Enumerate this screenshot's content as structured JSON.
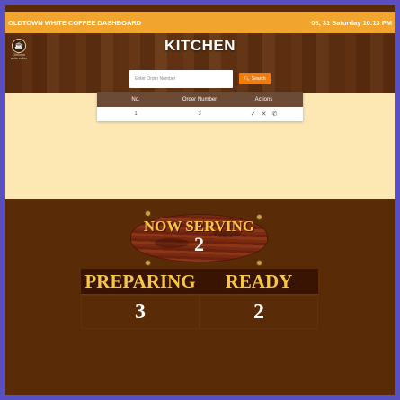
{
  "header": {
    "title": "OLDTOWN WHITE COFFEE DASHBOARD",
    "datetime": "08, 31 Saturday 10:13 PM"
  },
  "logo": {
    "line1": "OldTown",
    "line2": "white coffee"
  },
  "hero": {
    "title": "KITCHEN",
    "search_placeholder": "Enter Order Number",
    "search_button": "Search",
    "search_icon": "search-icon"
  },
  "orders_table": {
    "columns": [
      "No.",
      "Order Number",
      "Actions"
    ],
    "rows": [
      {
        "no": "1",
        "order_number": "3",
        "actions": [
          "check-icon",
          "close-icon",
          "phone-icon"
        ]
      }
    ]
  },
  "now_serving": {
    "label": "NOW SERVING",
    "value": "2"
  },
  "preparing": {
    "label": "PREPARING",
    "value": "3"
  },
  "ready": {
    "label": "READY",
    "value": "2"
  },
  "colors": {
    "topbar": "#f2a52e",
    "panel": "#fde8b4",
    "background": "#5a2b07",
    "accent_gold": "#f6c744",
    "search_button": "#f07d10",
    "table_header": "#6b4a36"
  }
}
